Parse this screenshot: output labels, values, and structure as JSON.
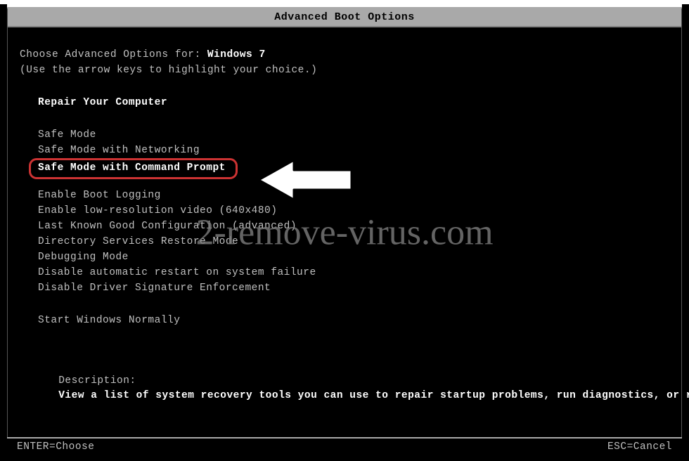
{
  "title": "Advanced Boot Options",
  "prompt_prefix": "Choose Advanced Options for: ",
  "os_name": "Windows 7",
  "instructions": "(Use the arrow keys to highlight your choice.)",
  "repair_item": "Repair Your Computer",
  "menu_group1": [
    "Safe Mode",
    "Safe Mode with Networking",
    "Safe Mode with Command Prompt"
  ],
  "highlighted_index": 2,
  "menu_group2": [
    "Enable Boot Logging",
    "Enable low-resolution video (640x480)",
    "Last Known Good Configuration (advanced)",
    "Directory Services Restore Mode",
    "Debugging Mode",
    "Disable automatic restart on system failure",
    "Disable Driver Signature Enforcement"
  ],
  "start_normally": "Start Windows Normally",
  "description_label": "Description:",
  "description_text": "View a list of system recovery tools you can use to repair startup problems, run diagnostics, or restore your system.",
  "footer_left": "ENTER=Choose",
  "footer_right": "ESC=Cancel",
  "watermark": "2-remove-virus.com"
}
